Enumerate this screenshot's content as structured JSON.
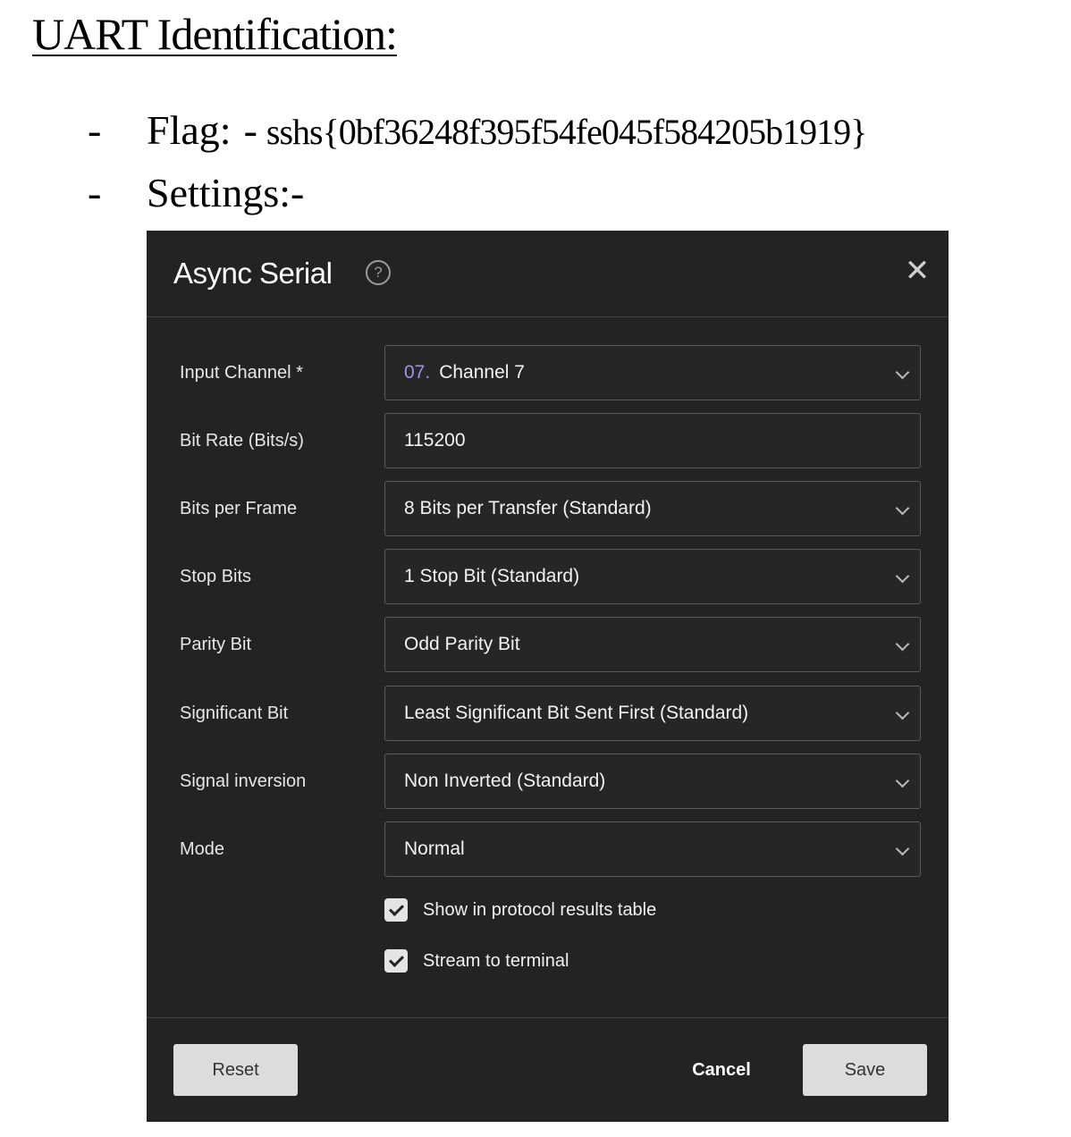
{
  "document": {
    "heading": "UART Identification:",
    "bullet_dash": "-",
    "flag_label": "Flag:",
    "flag_separator": "-",
    "flag_value": "sshs{0bf36248f395f54fe045f584205b1919}",
    "settings_label": "Settings:-"
  },
  "dialog": {
    "title": "Async Serial",
    "help_glyph": "?",
    "close_glyph": "✕",
    "fields": [
      {
        "label": "Input Channel *",
        "channel_num": "07.",
        "value": "Channel 7",
        "control": "select"
      },
      {
        "label": "Bit Rate (Bits/s)",
        "value": "115200",
        "control": "input"
      },
      {
        "label": "Bits per Frame",
        "value": "8 Bits per Transfer (Standard)",
        "control": "select"
      },
      {
        "label": "Stop Bits",
        "value": "1 Stop Bit (Standard)",
        "control": "select"
      },
      {
        "label": "Parity Bit",
        "value": "Odd Parity Bit",
        "control": "select"
      },
      {
        "label": "Significant Bit",
        "value": "Least Significant Bit Sent First (Standard)",
        "control": "select"
      },
      {
        "label": "Signal inversion",
        "value": "Non Inverted (Standard)",
        "control": "select"
      },
      {
        "label": "Mode",
        "value": "Normal",
        "control": "select"
      }
    ],
    "checkboxes": [
      {
        "label": "Show in protocol results table",
        "checked": true
      },
      {
        "label": "Stream to terminal",
        "checked": true
      }
    ],
    "buttons": {
      "reset": "Reset",
      "cancel": "Cancel",
      "save": "Save"
    },
    "colors": {
      "background": "#232323",
      "channel_accent": "#a38ff0",
      "button_light": "#dcdcdc"
    }
  }
}
